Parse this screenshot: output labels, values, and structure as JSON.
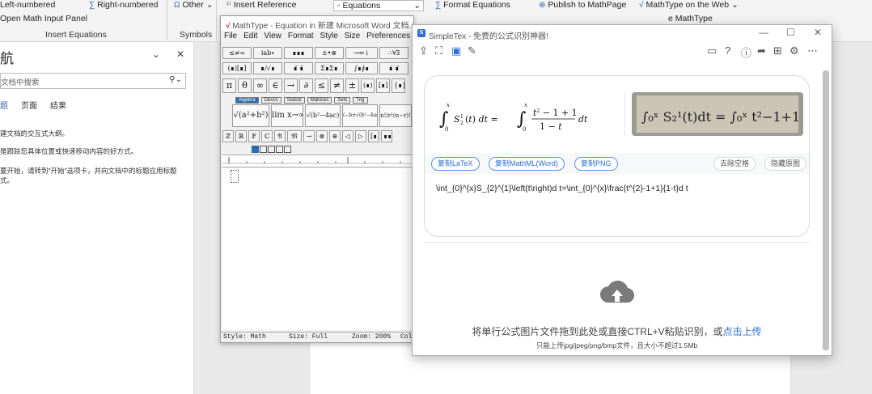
{
  "ribbon": {
    "left_numbered": "Left-numbered",
    "right_numbered": "Right-numbered",
    "other": "Other",
    "insert_reference": "Insert Reference",
    "equations": "Equations",
    "format_equations": "Format Equations",
    "publish_mathpage": "Publish to MathPage",
    "mathtype_web": "MathType on the Web",
    "mathtype_type_partial": "e MathType",
    "open_math_input": "Open Math Input Panel",
    "group_insert_equations": "Insert Equations",
    "group_symbols": "Symbols"
  },
  "nav": {
    "title": "航",
    "search_placeholder": "文档中搜索",
    "tabs": [
      "题",
      "页面",
      "结果"
    ],
    "line1": "建文档的交互式大纲。",
    "line2": "是跟踪您具体位置或快速移动内容的好方式。",
    "line3": "要开始，请转到\"开始\"选项卡，并向文档中的标题应用标题",
    "line4": "式。"
  },
  "mathtype": {
    "title": "MathType - Equation in 新建 Microsoft Word 文档.d",
    "menu": [
      "File",
      "Edit",
      "View",
      "Format",
      "Style",
      "Size",
      "Preferences"
    ],
    "toolbar_row1": [
      "≤≠≈",
      "ⅰab∙",
      "∎∎∎",
      "±•⊗",
      "→⇔↓",
      "∴∀∃"
    ],
    "toolbar_row2": [
      "(∎)[∎]",
      "∎∕√∎",
      "∎̈ ∎̂",
      "Σ∎Σ∎",
      "∫∎∮∎",
      "∎̄ ∎⃗"
    ],
    "toolbar_row3": [
      "π",
      "θ",
      "∞",
      "∈",
      "→",
      "∂",
      "≤",
      "≠",
      "±",
      "(∎)",
      "[∎]",
      "{∎}"
    ],
    "tabs": [
      "Algebra",
      "Derivs",
      "Statisti",
      "Matrices",
      "Sets",
      "Trig"
    ],
    "templates": [
      "√(a²+b²)",
      "lim x→∞",
      "√(b²−4ac)",
      "(−b±√(b²−4ac))/2a",
      "n!/r!(n−r)!"
    ],
    "toolbar_row5": [
      "ℤ",
      "ℝ",
      "𝔽",
      "ℂ",
      "𝔄",
      "𝔐",
      "→",
      "⊗",
      "⊕",
      "◁",
      "▷",
      "[∎]",
      "∎∎"
    ],
    "status_style": "Style: Math",
    "status_size": "Size: Full",
    "status_zoom": "Zoom: 200%",
    "status_col": "Col"
  },
  "simpletex": {
    "title": "SimpleTex - 免费的公式识别神器!",
    "btn_copy_latex": "复制LaTeX",
    "btn_copy_mathml": "复制MathML(Word)",
    "btn_copy_png": "复制PNG",
    "btn_remove_spaces": "去除空格",
    "btn_hide_original": "隐藏原图",
    "latex_code": "\\int_{0}^{x}S_{2}^{1}\\left(t\\right)d t=\\int_{0}^{x}\\frac{t^{2}-1+1}{1-t}d t",
    "upload_text": "将单行公式图片文件拖到此处或直接CTRL+V粘贴识别，或",
    "upload_link": "点击上传",
    "upload_sub": "只能上传jpg/jpeg/png/bmp文件，且大小不超过1.5Mb",
    "formula_photo": "∫₀ˣ S₂¹(t)dt = ∫₀ˣ t²−1+1 / 1−t dt"
  }
}
